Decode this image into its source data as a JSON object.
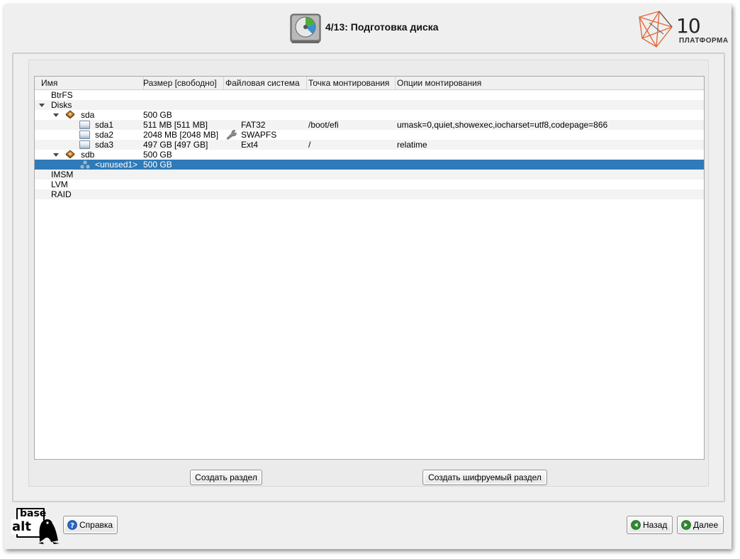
{
  "header": {
    "title": "4/13: Подготовка диска",
    "logo_number": "10",
    "logo_text": "ПЛАТФОРМА"
  },
  "tree": {
    "columns": [
      "Имя",
      "Размер [свободно]",
      "Файловая система",
      "Точка монтирования",
      "Опции монтирования"
    ],
    "rows": [
      {
        "name": "BtrFS",
        "size": "",
        "fs": "",
        "mount": "",
        "options": ""
      },
      {
        "name": "Disks",
        "size": "",
        "fs": "",
        "mount": "",
        "options": ""
      },
      {
        "name": "sda",
        "size": "500 GB",
        "fs": "",
        "mount": "",
        "options": ""
      },
      {
        "name": "sda1",
        "size": "511 MB [511 MB]",
        "fs": "FAT32",
        "mount": "/boot/efi",
        "options": "umask=0,quiet,showexec,iocharset=utf8,codepage=866"
      },
      {
        "name": "sda2",
        "size": "2048 MB [2048 MB]",
        "fs": "SWAPFS",
        "mount": "",
        "options": ""
      },
      {
        "name": "sda3",
        "size": "497 GB [497 GB]",
        "fs": "Ext4",
        "mount": "/",
        "options": "relatime"
      },
      {
        "name": "sdb",
        "size": "500 GB",
        "fs": "",
        "mount": "",
        "options": ""
      },
      {
        "name": "<unused1>",
        "size": "500 GB",
        "fs": "",
        "mount": "",
        "options": ""
      },
      {
        "name": "IMSM",
        "size": "",
        "fs": "",
        "mount": "",
        "options": ""
      },
      {
        "name": "LVM",
        "size": "",
        "fs": "",
        "mount": "",
        "options": ""
      },
      {
        "name": "RAID",
        "size": "",
        "fs": "",
        "mount": "",
        "options": ""
      }
    ]
  },
  "buttons": {
    "create_partition": "Создать раздел",
    "create_encrypted_partition": "Создать шифруемый раздел"
  },
  "footer": {
    "logo_top": "base",
    "logo_bottom": "alt",
    "help_label": "Справка",
    "back_label": "Назад",
    "next_label": "Далее"
  },
  "colors": {
    "selection": "#2f7ab8",
    "window_bg": "#efefef",
    "nav_icon_green": "#2e8b2e",
    "help_icon_blue": "#2a64c8"
  }
}
